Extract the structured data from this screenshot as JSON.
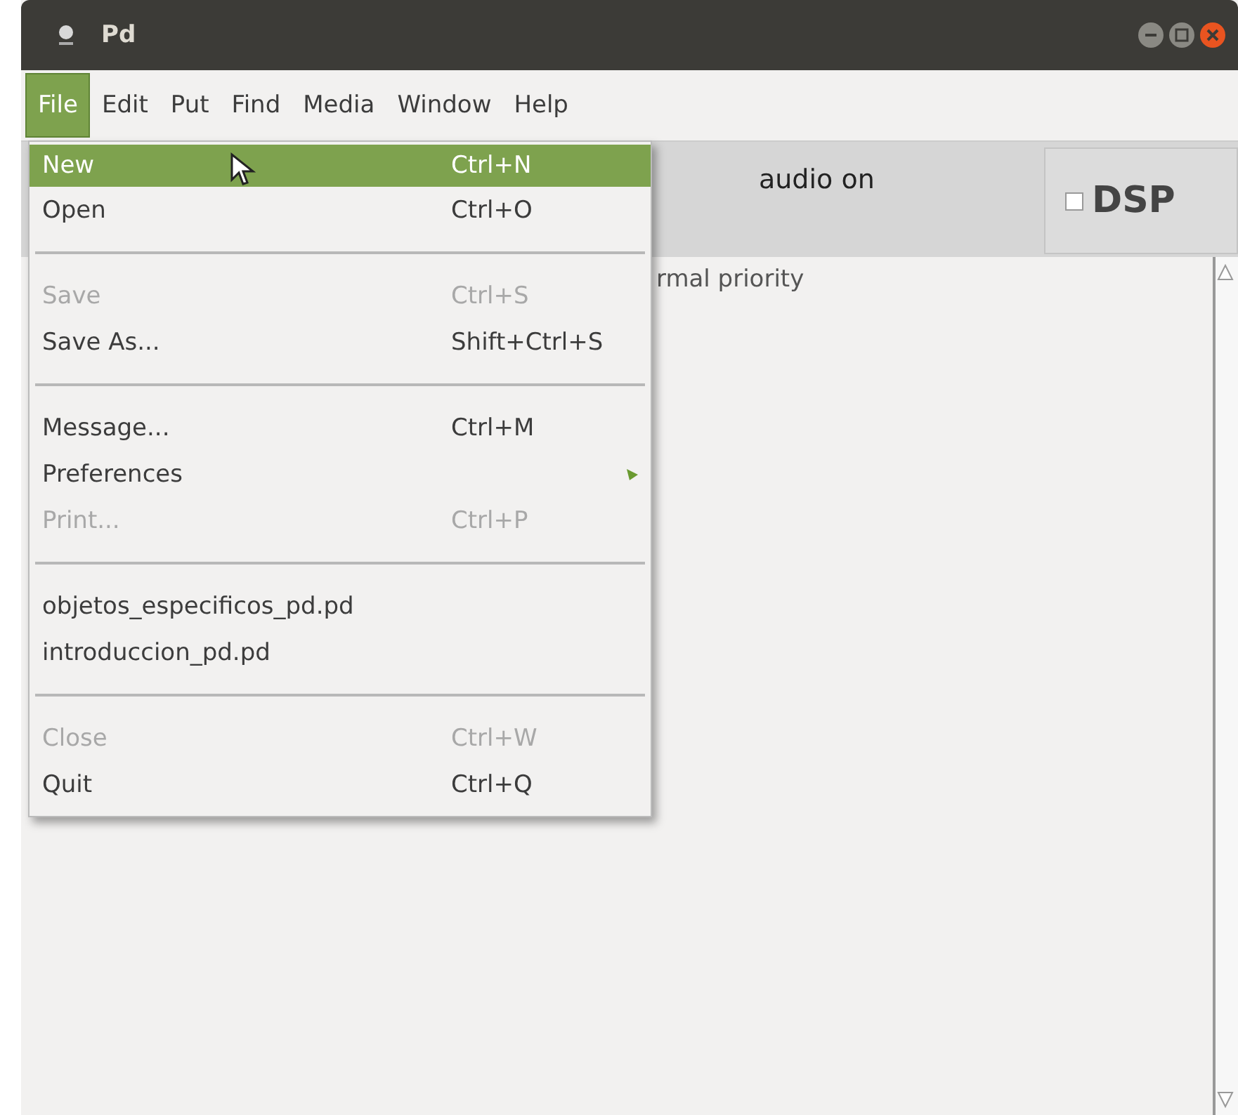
{
  "window": {
    "title": "Pd"
  },
  "menubar": [
    {
      "label": "File",
      "selected": true
    },
    {
      "label": "Edit",
      "selected": false
    },
    {
      "label": "Put",
      "selected": false
    },
    {
      "label": "Find",
      "selected": false
    },
    {
      "label": "Media",
      "selected": false
    },
    {
      "label": "Window",
      "selected": false
    },
    {
      "label": "Help",
      "selected": false
    }
  ],
  "audio_status": "audio on",
  "dsp": {
    "label": "DSP",
    "checked": false
  },
  "console": {
    "lines": [
      "rmal priority"
    ]
  },
  "file_menu": [
    {
      "kind": "item",
      "label": "New",
      "shortcut": "Ctrl+N",
      "selected": true,
      "disabled": false
    },
    {
      "kind": "item",
      "label": "Open",
      "shortcut": "Ctrl+O",
      "selected": false,
      "disabled": false
    },
    {
      "kind": "separator"
    },
    {
      "kind": "item",
      "label": "Save",
      "shortcut": "Ctrl+S",
      "selected": false,
      "disabled": true
    },
    {
      "kind": "item",
      "label": "Save As...",
      "shortcut": "Shift+Ctrl+S",
      "selected": false,
      "disabled": false
    },
    {
      "kind": "separator"
    },
    {
      "kind": "item",
      "label": "Message...",
      "shortcut": "Ctrl+M",
      "selected": false,
      "disabled": false
    },
    {
      "kind": "submenu",
      "label": "Preferences",
      "selected": false,
      "disabled": false
    },
    {
      "kind": "item",
      "label": "Print...",
      "shortcut": "Ctrl+P",
      "selected": false,
      "disabled": true
    },
    {
      "kind": "separator"
    },
    {
      "kind": "item",
      "label": "objetos_especificos_pd.pd",
      "selected": false,
      "disabled": false
    },
    {
      "kind": "item",
      "label": "introduccion_pd.pd",
      "selected": false,
      "disabled": false
    },
    {
      "kind": "separator"
    },
    {
      "kind": "item",
      "label": "Close",
      "shortcut": "Ctrl+W",
      "selected": false,
      "disabled": true
    },
    {
      "kind": "item",
      "label": "Quit",
      "shortcut": "Ctrl+Q",
      "selected": false,
      "disabled": false
    }
  ]
}
